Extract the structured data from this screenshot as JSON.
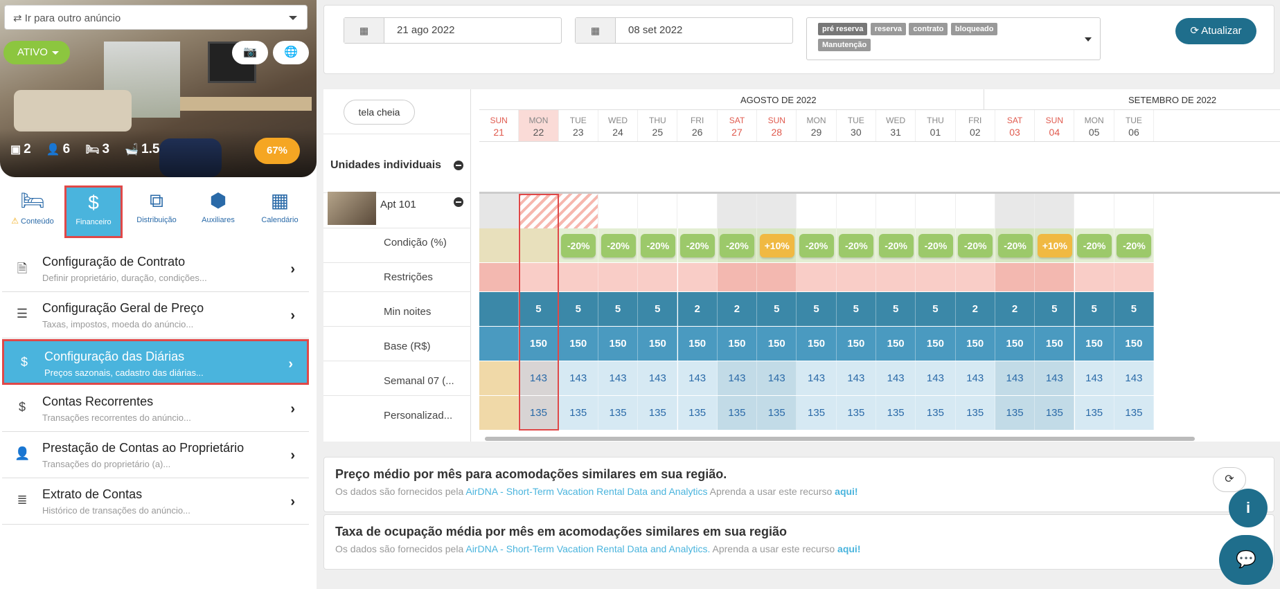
{
  "listing": {
    "goto_placeholder": "Ir para outro anúncio",
    "status": "ATIVO",
    "stats": {
      "units": "2",
      "guests": "6",
      "beds": "3",
      "baths": "1.5"
    },
    "occupancy": "67%"
  },
  "tabs": [
    {
      "label": "Conteúdo",
      "icon": "bed-icon"
    },
    {
      "label": "Financeiro",
      "icon": "dollar-icon"
    },
    {
      "label": "Distribuição",
      "icon": "sitemap-icon"
    },
    {
      "label": "Auxiliares",
      "icon": "cubes-icon"
    },
    {
      "label": "Calendário",
      "icon": "calendar-icon"
    }
  ],
  "menu": [
    {
      "title": "Configuração de Contrato",
      "sub": "Definir proprietário, duração, condições...",
      "icon": "document-icon"
    },
    {
      "title": "Configuração Geral de Preço",
      "sub": "Taxas, impostos, moeda do anúncio...",
      "icon": "sliders-icon"
    },
    {
      "title": "Configuração das Diárias",
      "sub": "Preços sazonais, cadastro das diárias...",
      "icon": "dollar-icon"
    },
    {
      "title": "Contas Recorrentes",
      "sub": "Transações recorrentes do anúncio...",
      "icon": "dollar-icon"
    },
    {
      "title": "Prestação de Contas ao Proprietário",
      "sub": "Transações do proprietário (a)...",
      "icon": "user-icon"
    },
    {
      "title": "Extrato de Contas",
      "sub": "Histórico de transações do anúncio...",
      "icon": "list-icon"
    }
  ],
  "filters": {
    "date_from": "21 ago 2022",
    "date_to": "08 set 2022",
    "tags": [
      "pré reserva",
      "reserva",
      "contrato",
      "bloqueado",
      "Manutenção"
    ],
    "refresh_label": "Atualizar"
  },
  "calendar": {
    "fullscreen_label": "tela cheia",
    "months": [
      "AGOSTO DE 2022",
      "SETEMBRO DE 2022"
    ],
    "section_title": "Unidades individuais",
    "unit_name": "Apt 101",
    "row_labels": [
      "Condição (%)",
      "Restrições",
      "Min noites",
      "Base (R$)",
      "Semanal 07 (...",
      "Personalizad..."
    ],
    "days": [
      {
        "n": "SUN",
        "d": "21"
      },
      {
        "n": "MON",
        "d": "22"
      },
      {
        "n": "TUE",
        "d": "23"
      },
      {
        "n": "WED",
        "d": "24"
      },
      {
        "n": "THU",
        "d": "25"
      },
      {
        "n": "FRI",
        "d": "26"
      },
      {
        "n": "SAT",
        "d": "27"
      },
      {
        "n": "SUN",
        "d": "28"
      },
      {
        "n": "MON",
        "d": "29"
      },
      {
        "n": "TUE",
        "d": "30"
      },
      {
        "n": "WED",
        "d": "31"
      },
      {
        "n": "THU",
        "d": "01"
      },
      {
        "n": "FRI",
        "d": "02"
      },
      {
        "n": "SAT",
        "d": "03"
      },
      {
        "n": "SUN",
        "d": "04"
      },
      {
        "n": "MON",
        "d": "05"
      },
      {
        "n": "TUE",
        "d": "06"
      }
    ],
    "conditions": [
      "",
      "",
      "-20%",
      "-20%",
      "-20%",
      "-20%",
      "-20%",
      "+10%",
      "-20%",
      "-20%",
      "-20%",
      "-20%",
      "-20%",
      "-20%",
      "+10%",
      "-20%",
      "-20%"
    ],
    "min_nights": [
      "",
      "5",
      "5",
      "5",
      "5",
      "2",
      "2",
      "5",
      "5",
      "5",
      "5",
      "5",
      "2",
      "2",
      "5",
      "5",
      "5"
    ],
    "base": [
      "",
      "150",
      "150",
      "150",
      "150",
      "150",
      "150",
      "150",
      "150",
      "150",
      "150",
      "150",
      "150",
      "150",
      "150",
      "150",
      "150"
    ],
    "weekly": [
      "",
      "143",
      "143",
      "143",
      "143",
      "143",
      "143",
      "143",
      "143",
      "143",
      "143",
      "143",
      "143",
      "143",
      "143",
      "143",
      "143"
    ],
    "custom": [
      "",
      "135",
      "135",
      "135",
      "135",
      "135",
      "135",
      "135",
      "135",
      "135",
      "135",
      "135",
      "135",
      "135",
      "135",
      "135",
      "135"
    ]
  },
  "panels": [
    {
      "title": "Preço médio por mês para acomodações similares em sua região.",
      "text": "Os dados são fornecidos pela",
      "link": "AirDNA - Short-Term Vacation Rental Data and Analytics",
      "learn": "Aprenda a usar este recurso",
      "aqui": "aqui!"
    },
    {
      "title": "Taxa de ocupação média por mês em acomodações similares em sua região",
      "text": "Os dados são fornecidos pela",
      "link": "AirDNA - Short-Term Vacation Rental Data and Analytics.",
      "learn": "Aprenda a usar este recurso",
      "aqui": "aqui!"
    }
  ]
}
